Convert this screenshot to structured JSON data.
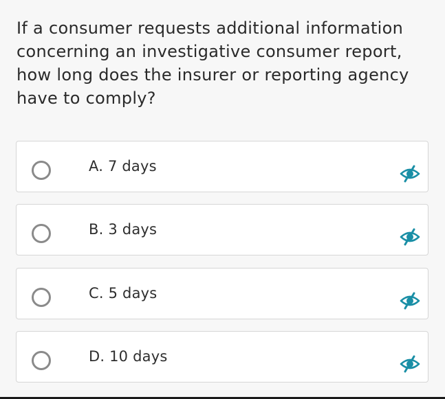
{
  "question": {
    "text": "If a consumer requests additional information concerning an investigative consumer report, how long does the insurer or reporting agency have to comply?"
  },
  "options": [
    {
      "label": "A. 7 days",
      "selected": false
    },
    {
      "label": "B. 3 days",
      "selected": false
    },
    {
      "label": "C. 5 days",
      "selected": false
    },
    {
      "label": "D. 10 days",
      "selected": false
    }
  ],
  "icons": {
    "option_hide": "eye-slash-icon",
    "radio": "radio-unselected-icon"
  },
  "colors": {
    "accent": "#1a8fa6",
    "radio_border": "#8a8a8a",
    "card_border": "#d6d6d6",
    "background": "#f7f7f7"
  }
}
